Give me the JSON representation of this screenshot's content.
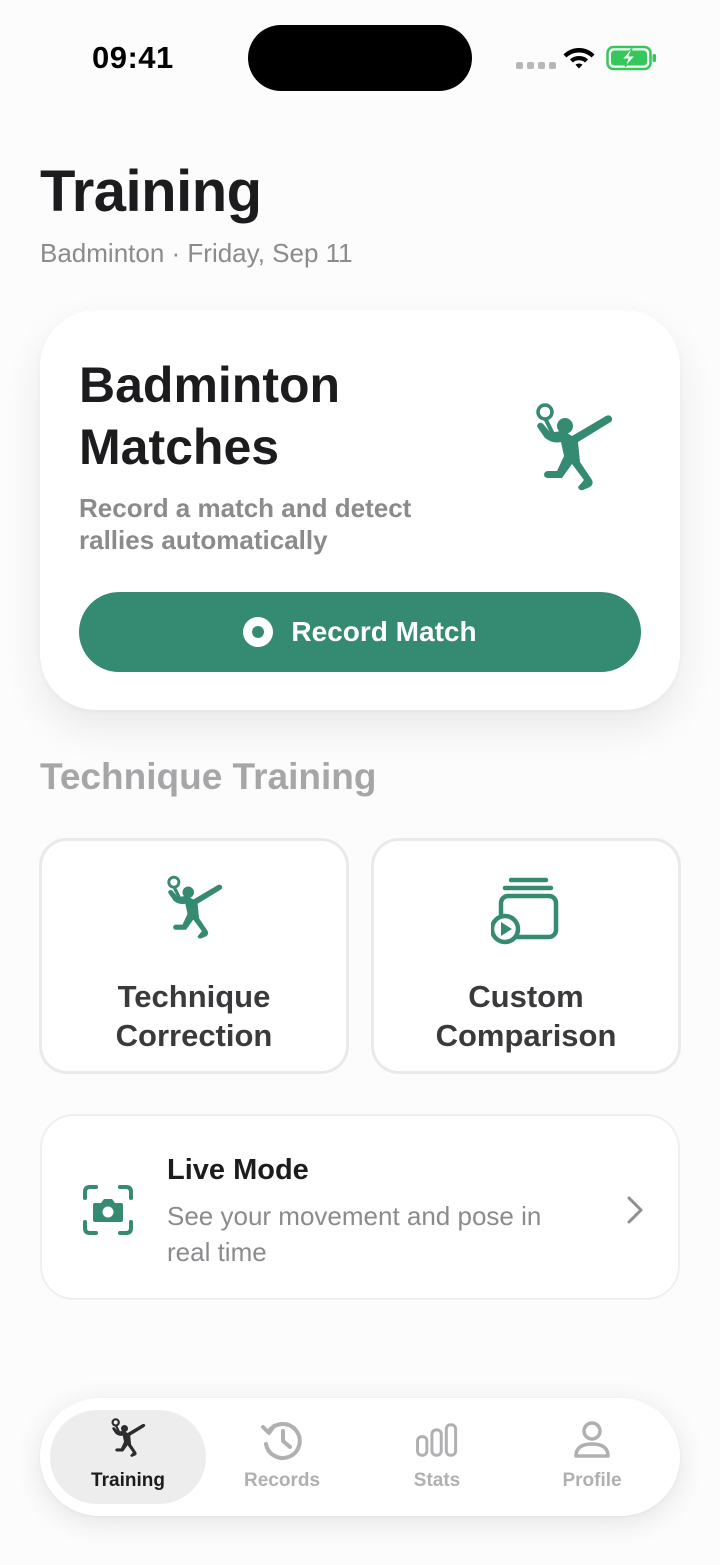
{
  "status_bar": {
    "time": "09:41"
  },
  "header": {
    "title": "Training",
    "subtitle": "Badminton · Friday, Sep 11"
  },
  "hero": {
    "title": "Badminton Matches",
    "description": "Record a match and detect rallies automatically",
    "button_label": "Record Match",
    "icon": "badminton-player-icon"
  },
  "technique": {
    "section_title": "Technique Training",
    "tiles": [
      {
        "label": "Technique Correction",
        "icon": "badminton-player-icon"
      },
      {
        "label": "Custom Comparison",
        "icon": "video-stack-icon"
      }
    ]
  },
  "live_mode": {
    "title": "Live Mode",
    "description": "See your movement and pose in real time",
    "icon": "camera-scan-icon"
  },
  "tab_bar": {
    "tabs": [
      {
        "label": "Training",
        "icon": "badminton-player-icon",
        "active": true
      },
      {
        "label": "Records",
        "icon": "history-icon",
        "active": false
      },
      {
        "label": "Stats",
        "icon": "bar-chart-icon",
        "active": false
      },
      {
        "label": "Profile",
        "icon": "person-icon",
        "active": false
      }
    ]
  },
  "colors": {
    "accent": "#358a72",
    "background": "#fcfcfc",
    "secondary_text": "#8b8b8e"
  }
}
